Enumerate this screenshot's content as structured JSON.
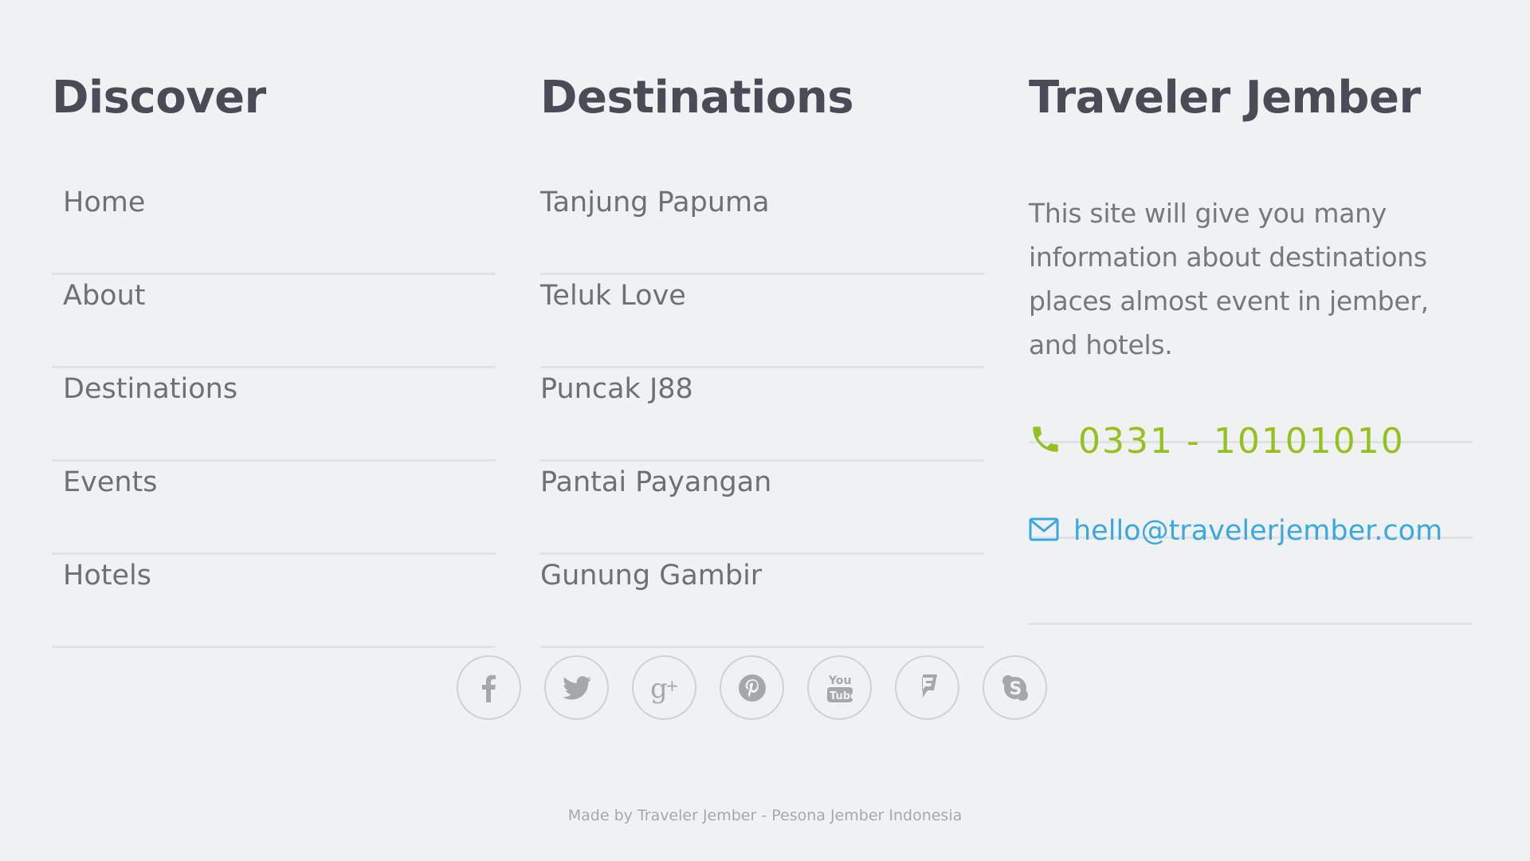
{
  "discover": {
    "title": "Discover",
    "links": [
      "Home",
      "About",
      "Destinations",
      "Events",
      "Hotels"
    ]
  },
  "destinations": {
    "title": "Destinations",
    "links": [
      "Tanjung Papuma",
      "Teluk Love",
      "Puncak J88",
      "Pantai Payangan",
      "Gunung Gambir"
    ]
  },
  "about": {
    "title": "Traveler Jember",
    "text": "This site will give you many information about destinations places almost event in jember, and hotels.",
    "phone": "0331 - 10101010",
    "email": "hello@travelerjember.com"
  },
  "social": [
    "facebook-icon",
    "twitter-icon",
    "google-plus-icon",
    "pinterest-icon",
    "youtube-icon",
    "foursquare-icon",
    "skype-icon"
  ],
  "credit": "Made by Traveler Jember - Pesona Jember Indonesia",
  "colors": {
    "heading": "#4a4b57",
    "link": "#6f7075",
    "phone": "#95c11f",
    "email": "#3aa8e2",
    "divider": "#e0e2e5",
    "background": "#f0f1f3"
  }
}
